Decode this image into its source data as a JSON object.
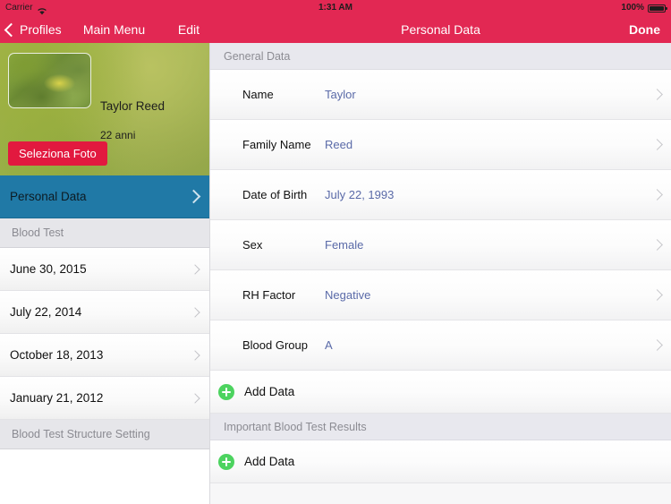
{
  "status_bar": {
    "carrier": "Carrier",
    "wifi_icon": "wifi-icon",
    "time": "1:31 AM",
    "battery_percent": "100%",
    "battery_icon": "battery-full-icon"
  },
  "theme": {
    "nav_red": "#E22853",
    "selected_blue": "#2079A6",
    "button_red": "#E2193F",
    "add_green": "#4CD35F",
    "value_blue": "#5A6AA8",
    "section_header_bg": "#E8E8EE"
  },
  "sidebar_nav": {
    "back_label": "Profiles",
    "back_icon": "chevron-left-icon",
    "title": "Main Menu",
    "edit_label": "Edit"
  },
  "detail_nav": {
    "title": "Personal Data",
    "done_label": "Done"
  },
  "profile": {
    "photo_icon": "profile-photo-thumbnail",
    "name": "Taylor Reed",
    "age": "22 anni",
    "select_photo_label": "Seleziona Foto"
  },
  "sidebar": {
    "main_item": {
      "label": "Personal Data",
      "selected": true,
      "chevron_icon": "chevron-right-icon"
    },
    "blood_test_header": "Blood Test",
    "blood_tests": [
      {
        "label": "June 30, 2015",
        "chevron_icon": "chevron-right-icon"
      },
      {
        "label": "July 22, 2014",
        "chevron_icon": "chevron-right-icon"
      },
      {
        "label": "October 18, 2013",
        "chevron_icon": "chevron-right-icon"
      },
      {
        "label": "January 21, 2012",
        "chevron_icon": "chevron-right-icon"
      }
    ],
    "structure_setting_header": "Blood Test Structure Setting"
  },
  "detail": {
    "general_section_title": "General Data",
    "fields": [
      {
        "label": "Name",
        "value": "Taylor",
        "chevron_icon": "chevron-right-icon"
      },
      {
        "label": "Family Name",
        "value": "Reed",
        "chevron_icon": "chevron-right-icon"
      },
      {
        "label": "Date of Birth",
        "value": "July 22, 1993",
        "chevron_icon": "chevron-right-icon"
      },
      {
        "label": "Sex",
        "value": "Female",
        "chevron_icon": "chevron-right-icon"
      },
      {
        "label": "RH Factor",
        "value": "Negative",
        "chevron_icon": "chevron-right-icon"
      },
      {
        "label": "Blood Group",
        "value": "A",
        "chevron_icon": "chevron-right-icon"
      }
    ],
    "add_data_general": {
      "label": "Add Data",
      "icon": "add-plus-circle-icon"
    },
    "important_section_title": "Important Blood Test Results",
    "add_data_important": {
      "label": "Add Data",
      "icon": "add-plus-circle-icon"
    }
  }
}
